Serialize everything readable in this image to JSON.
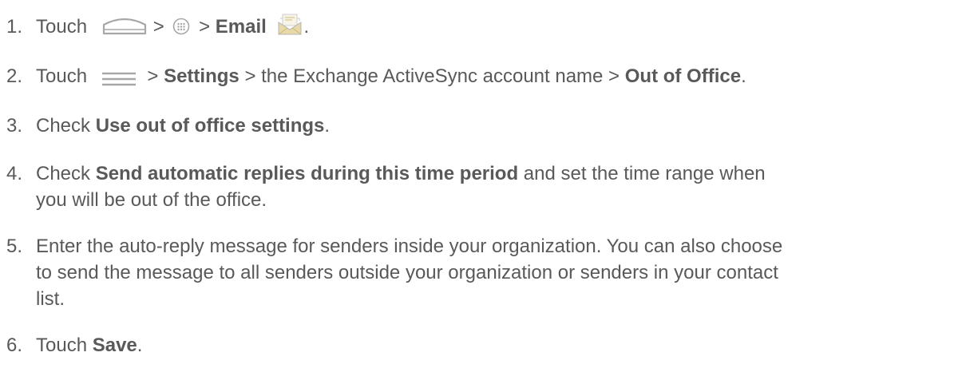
{
  "steps": [
    {
      "number": "1.",
      "touch": "Touch",
      "sep1": ">",
      "sep2": ">",
      "email": "Email",
      "end": ".",
      "icons": [
        "home-icon",
        "apps-icon",
        "email-icon"
      ]
    },
    {
      "number": "2.",
      "touch": "Touch",
      "sep1": ">",
      "settings": "Settings",
      "middle": "> the Exchange ActiveSync account name >",
      "out_of_office": "Out of Office",
      "end": ".",
      "icons": [
        "menu-icon"
      ]
    },
    {
      "number": "3.",
      "check": "Check",
      "option": "Use out of office settings",
      "end": "."
    },
    {
      "number": "4.",
      "check": "Check",
      "option": "Send automatic replies during this time period",
      "rest_line1": "and set the time range when",
      "rest_line2": "you will be out of the office."
    },
    {
      "number": "5.",
      "line1": "Enter the auto-reply message for senders inside your organization. You can also choose",
      "line2": "to send the message to all senders outside your organization or senders in your contact",
      "line3": "list."
    },
    {
      "number": "6.",
      "touch": "Touch",
      "save": "Save",
      "end": "."
    }
  ],
  "colors": {
    "text": "#595959",
    "icon_gray": "#a7a7a7",
    "email_envelope": "#e8d9a8"
  }
}
